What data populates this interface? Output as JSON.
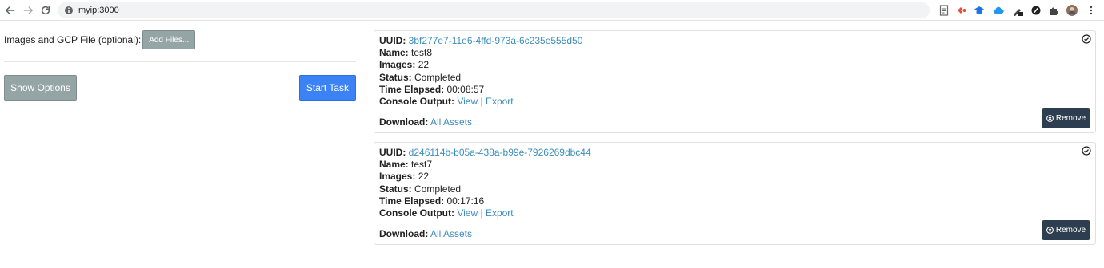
{
  "browser": {
    "url": "myip:3000"
  },
  "upload": {
    "label": "Images and GCP File (optional):",
    "add_files": "Add Files..."
  },
  "actions": {
    "show_options": "Show Options",
    "start_task": "Start Task"
  },
  "labels": {
    "uuid": "UUID:",
    "name": "Name:",
    "images": "Images:",
    "status": "Status:",
    "time_elapsed": "Time Elapsed:",
    "console_output": "Console Output:",
    "view": "View",
    "separator": "|",
    "export": "Export",
    "download": "Download:",
    "all_assets": "All Assets",
    "remove": "Remove"
  },
  "tasks": [
    {
      "uuid": "3bf277e7-11e6-4ffd-973a-6c235e555d50",
      "name": "test8",
      "images": "22",
      "status": "Completed",
      "time_elapsed": "00:08:57"
    },
    {
      "uuid": "d246114b-b05a-438a-b99e-7926269dbc44",
      "name": "test7",
      "images": "22",
      "status": "Completed",
      "time_elapsed": "00:17:16"
    }
  ]
}
